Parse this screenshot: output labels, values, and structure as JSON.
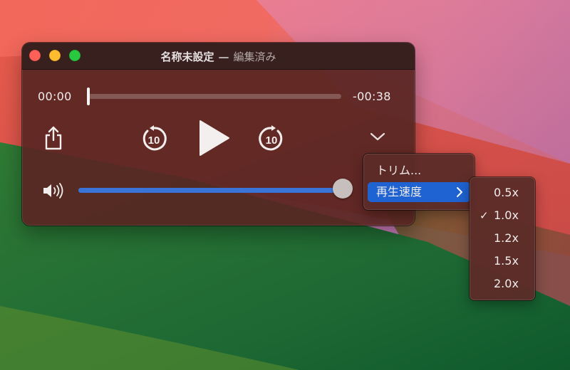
{
  "window": {
    "title": "名称未設定",
    "separator": "—",
    "status": "編集済み"
  },
  "player": {
    "elapsed": "00:00",
    "remaining": "-00:38",
    "progress": 0.0,
    "volume": 1.0,
    "skip_back_seconds": "10",
    "skip_forward_seconds": "10"
  },
  "menu": {
    "items": [
      {
        "label": "トリム..."
      },
      {
        "label": "再生速度",
        "highlighted": true,
        "submenu": true
      }
    ]
  },
  "speed_submenu": {
    "options": [
      {
        "label": "0.5x",
        "checked": false
      },
      {
        "label": "1.0x",
        "checked": true
      },
      {
        "label": "1.2x",
        "checked": false
      },
      {
        "label": "1.5x",
        "checked": false
      },
      {
        "label": "2.0x",
        "checked": false
      }
    ],
    "check_mark": "✓"
  },
  "icons": {
    "share": "share-icon",
    "skip_back": "skip-back-10-icon",
    "play": "play-icon",
    "skip_forward": "skip-forward-10-icon",
    "more": "chevron-down-icon",
    "volume": "speaker-icon",
    "submenu": "chevron-right-icon"
  },
  "colors": {
    "accent": "#1f63d2",
    "volume_fill": "#3a74d8",
    "close": "#fe5f57",
    "minimize": "#febc2e",
    "zoom": "#28c840"
  }
}
